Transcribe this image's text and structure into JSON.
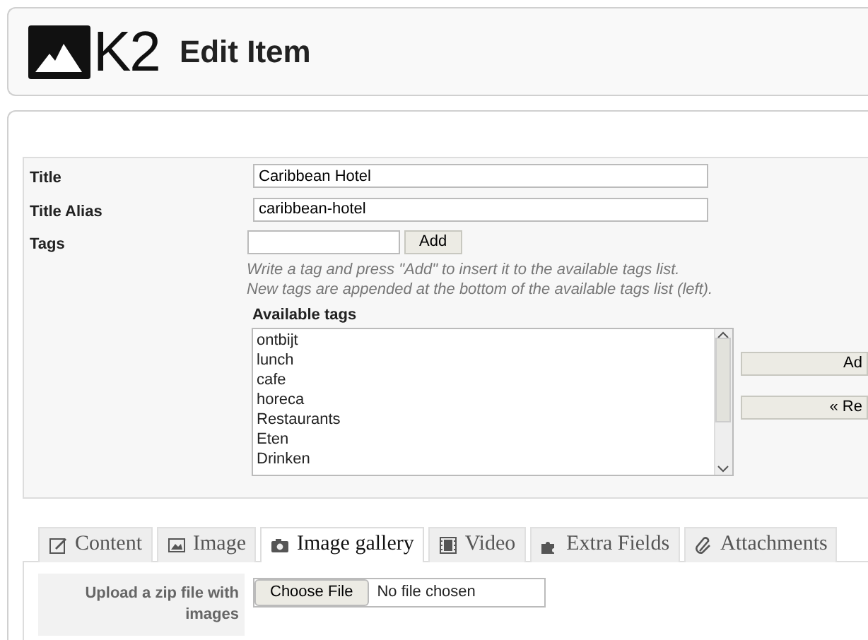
{
  "header": {
    "logo_text": "K2",
    "title": "Edit Item"
  },
  "fields": [
    {
      "label": "Title",
      "value": "Caribbean Hotel"
    },
    {
      "label": "Title Alias",
      "value": "caribbean-hotel"
    }
  ],
  "tags": {
    "label": "Tags",
    "add_button": "Add",
    "help": [
      "Write a tag and press \"Add\" to insert it to the available tags list.",
      "New tags are appended at the bottom of the available tags list (left)."
    ],
    "available_label": "Available tags",
    "available": [
      "ontbijt",
      "lunch",
      "cafe",
      "horeca",
      "Restaurants",
      "Eten",
      "Drinken"
    ],
    "side_buttons": [
      "Ad",
      "« Re"
    ]
  },
  "tabs": [
    {
      "label": "Content",
      "kind": "edit",
      "selected": false
    },
    {
      "label": "Image",
      "kind": "image",
      "selected": false
    },
    {
      "label": "Image gallery",
      "kind": "camera",
      "selected": true
    },
    {
      "label": "Video",
      "kind": "film",
      "selected": false
    },
    {
      "label": "Extra Fields",
      "kind": "puzzle",
      "selected": false
    },
    {
      "label": "Attachments",
      "kind": "clip",
      "selected": false
    }
  ],
  "gallery": {
    "label": "Upload a zip file with images",
    "button": "Choose File",
    "status": "No file chosen"
  }
}
